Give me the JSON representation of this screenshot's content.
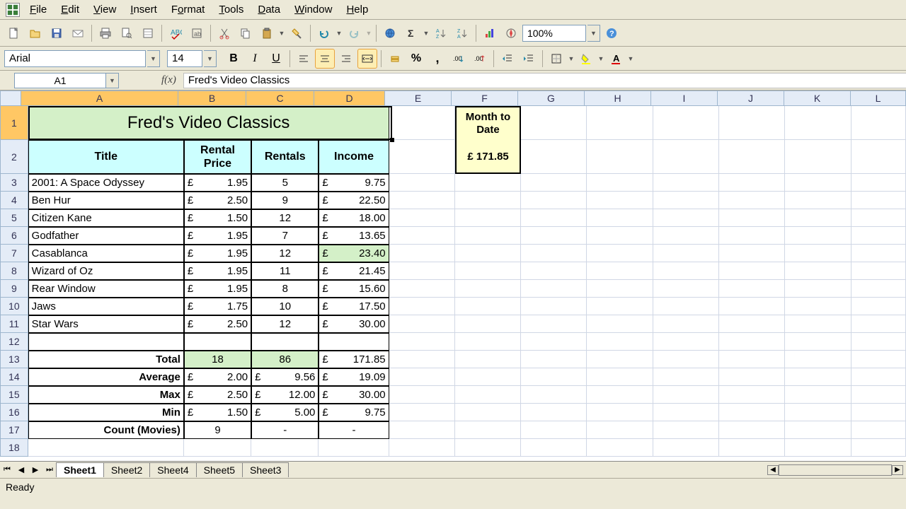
{
  "menu": {
    "file": "File",
    "edit": "Edit",
    "view": "View",
    "insert": "Insert",
    "format": "Format",
    "tools": "Tools",
    "data": "Data",
    "window": "Window",
    "help": "Help"
  },
  "toolbar": {
    "zoom": "100%"
  },
  "format": {
    "font": "Arial",
    "size": "14"
  },
  "namebox": "A1",
  "formula": "Fred's Video Classics",
  "columns": [
    "A",
    "B",
    "C",
    "D",
    "E",
    "F",
    "G",
    "H",
    "I",
    "J",
    "K",
    "L"
  ],
  "title_cell": "Fred's Video Classics",
  "headers": {
    "title": "Title",
    "price": "Rental Price",
    "rentals": "Rentals",
    "income": "Income"
  },
  "month_label": "Month to Date",
  "month_value_sym": "£",
  "month_value": "171.85",
  "rows": [
    {
      "n": 3,
      "title": "2001: A Space Odyssey",
      "price": "1.95",
      "rentals": "5",
      "income": "9.75"
    },
    {
      "n": 4,
      "title": "Ben Hur",
      "price": "2.50",
      "rentals": "9",
      "income": "22.50"
    },
    {
      "n": 5,
      "title": "Citizen Kane",
      "price": "1.50",
      "rentals": "12",
      "income": "18.00"
    },
    {
      "n": 6,
      "title": "Godfather",
      "price": "1.95",
      "rentals": "7",
      "income": "13.65"
    },
    {
      "n": 7,
      "title": "Casablanca",
      "price": "1.95",
      "rentals": "12",
      "income": "23.40",
      "green": true
    },
    {
      "n": 8,
      "title": "Wizard of Oz",
      "price": "1.95",
      "rentals": "11",
      "income": "21.45"
    },
    {
      "n": 9,
      "title": "Rear Window",
      "price": "1.95",
      "rentals": "8",
      "income": "15.60"
    },
    {
      "n": 10,
      "title": "Jaws",
      "price": "1.75",
      "rentals": "10",
      "income": "17.50"
    },
    {
      "n": 11,
      "title": "Star Wars",
      "price": "2.50",
      "rentals": "12",
      "income": "30.00"
    }
  ],
  "summary": {
    "total": {
      "label": "Total",
      "b": "18",
      "c": "86",
      "d": "171.85",
      "b_green": true,
      "c_green": true
    },
    "average": {
      "label": "Average",
      "b": "2.00",
      "c": "9.56",
      "d": "19.09",
      "b_cur": true,
      "c_cur": true
    },
    "max": {
      "label": "Max",
      "b": "2.50",
      "c": "12.00",
      "d": "30.00",
      "b_cur": true,
      "c_cur": true
    },
    "min": {
      "label": "Min",
      "b": "1.50",
      "c": "5.00",
      "d": "9.75",
      "b_cur": true,
      "c_cur": true
    },
    "count": {
      "label": "Count (Movies)",
      "b": "9",
      "c": "-",
      "d": "-"
    }
  },
  "currency_symbol": "£",
  "tabs": [
    "Sheet1",
    "Sheet2",
    "Sheet4",
    "Sheet5",
    "Sheet3"
  ],
  "active_tab": 0,
  "status": "Ready"
}
